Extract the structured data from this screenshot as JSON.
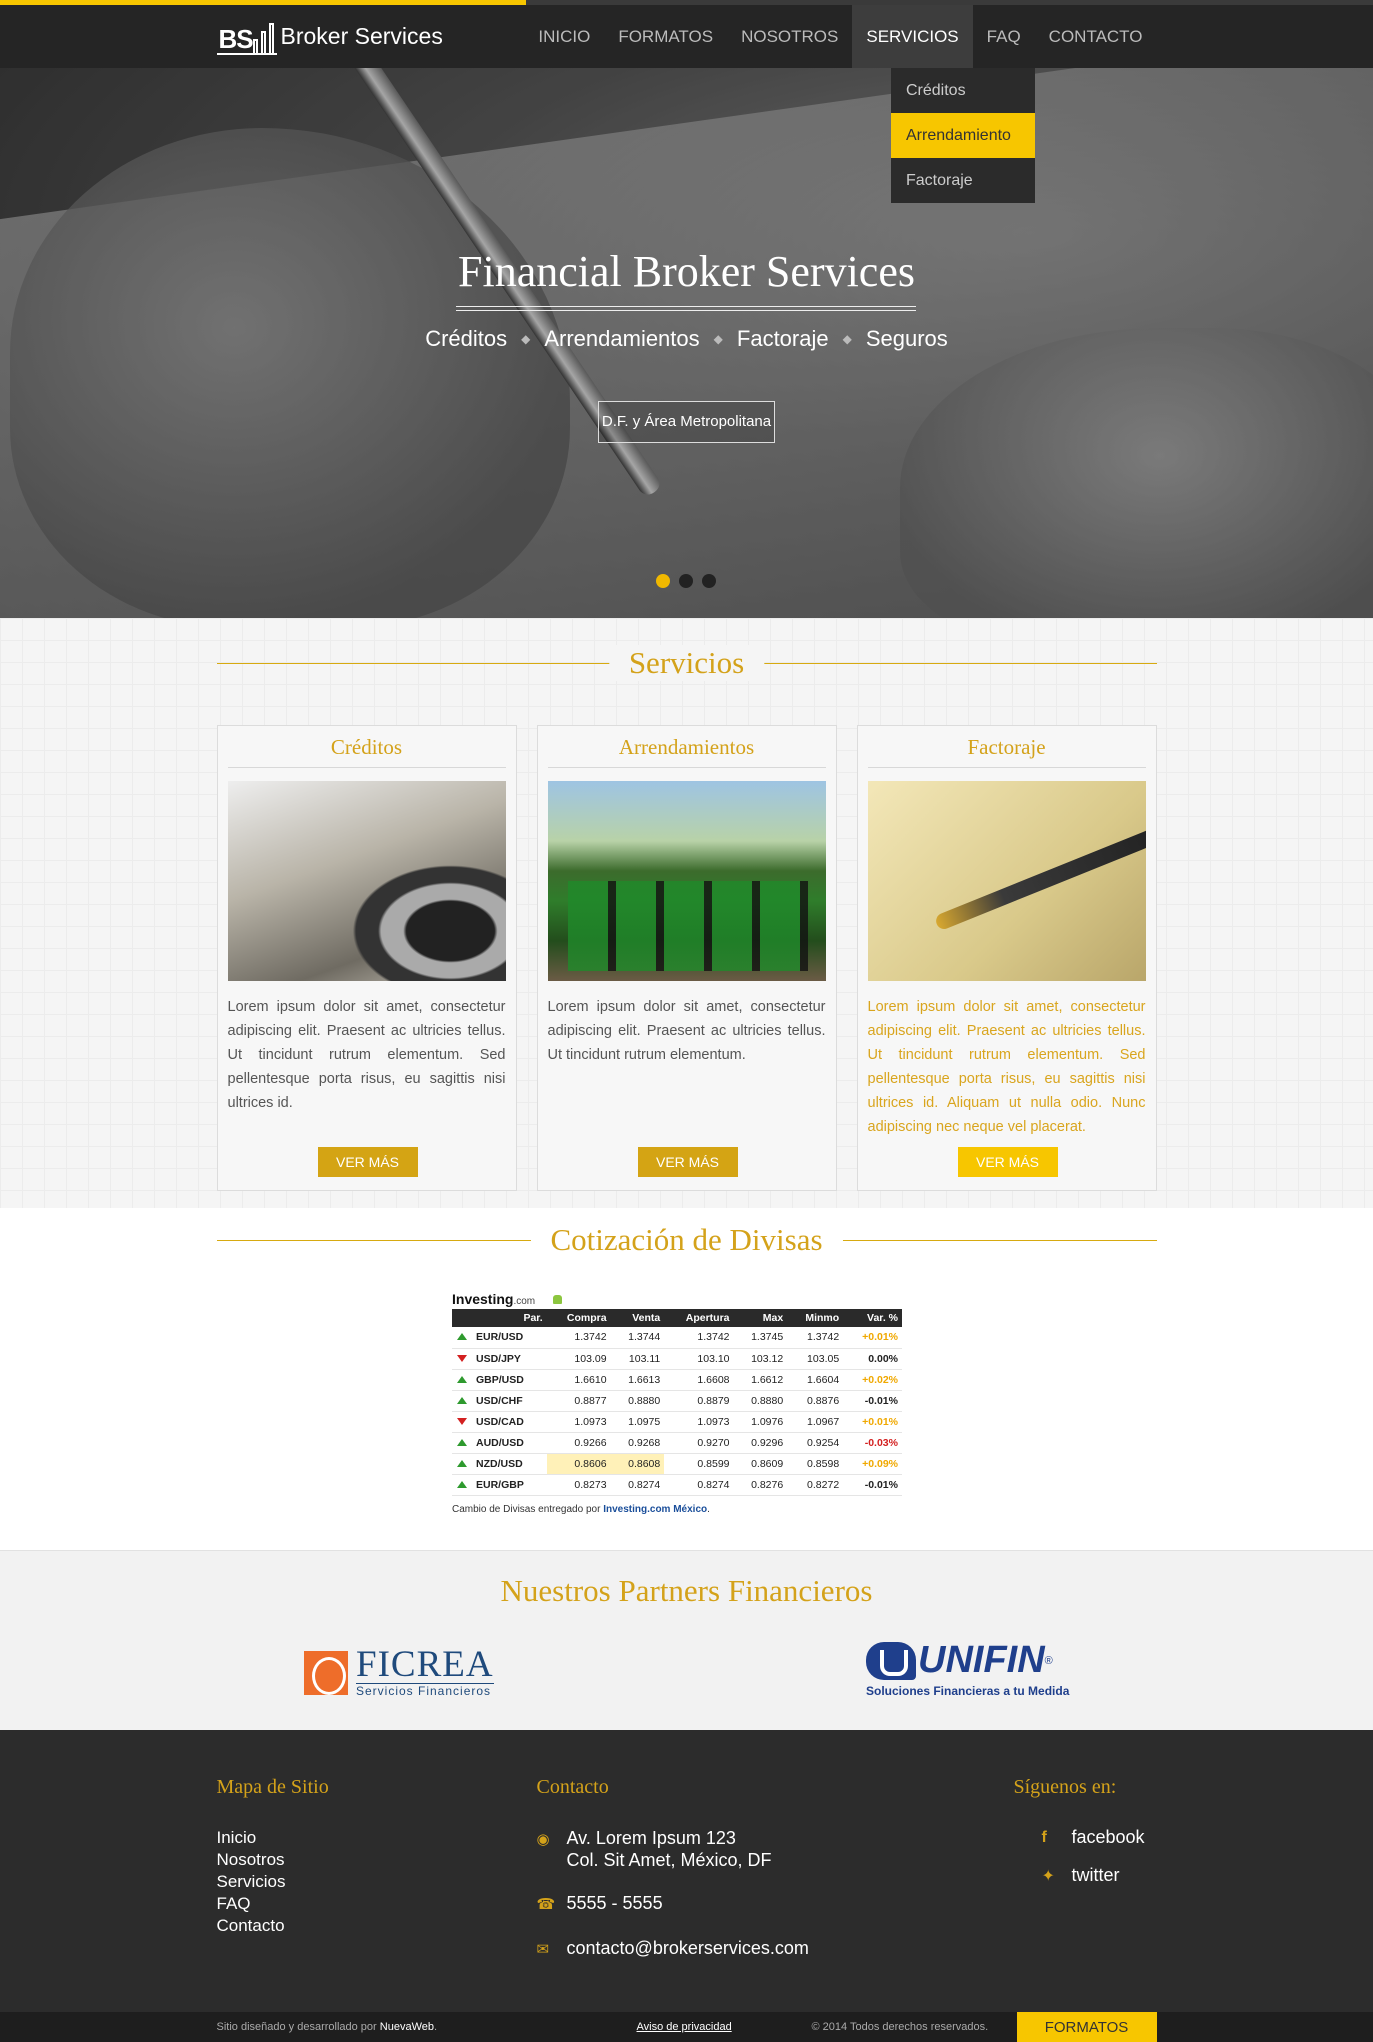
{
  "brand": {
    "logo_text": "BS",
    "name": "Broker Services"
  },
  "nav": {
    "items": [
      "INICIO",
      "FORMATOS",
      "NOSOTROS",
      "SERVICIOS",
      "FAQ",
      "CONTACTO"
    ],
    "active": "SERVICIOS",
    "dropdown": [
      "Créditos",
      "Arrendamiento",
      "Factoraje"
    ],
    "dropdown_highlight": "Arrendamiento"
  },
  "hero": {
    "title": "Financial Broker Services",
    "subtitles": [
      "Créditos",
      "Arrendamientos",
      "Factoraje",
      "Seguros"
    ],
    "separator": "◆",
    "button": "D.F. y Área Metropolitana",
    "slides": 3,
    "active_slide": 1
  },
  "servicios": {
    "title": "Servicios",
    "cards": [
      {
        "title": "Créditos",
        "image": "car-photo",
        "text": "Lorem ipsum dolor sit amet, consectetur adipiscing elit. Praesent ac ultricies tellus. Ut tincidunt rutrum elementum. Sed pellentesque porta risus, eu sagittis nisi ultrices id.",
        "button": "VER MÁS",
        "highlighted": false
      },
      {
        "title": "Arrendamientos",
        "image": "tractor-photo",
        "text": "Lorem ipsum dolor sit amet, consectetur adipiscing elit. Praesent ac ultricies tellus. Ut tincidunt rutrum elementum.",
        "button": "VER MÁS",
        "highlighted": false
      },
      {
        "title": "Factoraje",
        "image": "pen-signature-photo",
        "text": "Lorem ipsum dolor sit amet, consectetur adipiscing elit. Praesent ac ultricies tellus. Ut tincidunt rutrum elementum. Sed pellentesque porta risus, eu sagittis nisi ultrices id. Aliquam ut nulla odio. Nunc adipiscing nec neque vel placerat.",
        "button": "VER MÁS",
        "highlighted": true
      }
    ]
  },
  "divisas": {
    "title": "Cotización de Divisas",
    "widget_brand": "Investing",
    "widget_brand_suffix": ".com",
    "headers": [
      "",
      "Par.",
      "Compra",
      "Venta",
      "Apertura",
      "Max",
      "Minmo",
      "Var. %"
    ],
    "rows": [
      {
        "dir": "up",
        "pair": "EUR/USD",
        "compra": "1.3742",
        "venta": "1.3744",
        "apertura": "1.3742",
        "max": "1.3745",
        "min": "1.3742",
        "var": "+0.01%",
        "var_color": "#f0a800"
      },
      {
        "dir": "down",
        "pair": "USD/JPY",
        "compra": "103.09",
        "venta": "103.11",
        "apertura": "103.10",
        "max": "103.12",
        "min": "103.05",
        "var": "0.00%",
        "var_color": "#222222"
      },
      {
        "dir": "up",
        "pair": "GBP/USD",
        "compra": "1.6610",
        "venta": "1.6613",
        "apertura": "1.6608",
        "max": "1.6612",
        "min": "1.6604",
        "var": "+0.02%",
        "var_color": "#f0a800"
      },
      {
        "dir": "up",
        "pair": "USD/CHF",
        "compra": "0.8877",
        "venta": "0.8880",
        "apertura": "0.8879",
        "max": "0.8880",
        "min": "0.8876",
        "var": "-0.01%",
        "var_color": "#222222"
      },
      {
        "dir": "down",
        "pair": "USD/CAD",
        "compra": "1.0973",
        "venta": "1.0975",
        "apertura": "1.0973",
        "max": "1.0976",
        "min": "1.0967",
        "var": "+0.01%",
        "var_color": "#f0a800"
      },
      {
        "dir": "up",
        "pair": "AUD/USD",
        "compra": "0.9266",
        "venta": "0.9268",
        "apertura": "0.9270",
        "max": "0.9296",
        "min": "0.9254",
        "var": "-0.03%",
        "var_color": "#d32020"
      },
      {
        "dir": "up",
        "pair": "NZD/USD",
        "compra": "0.8606",
        "venta": "0.8608",
        "apertura": "0.8599",
        "max": "0.8609",
        "min": "0.8598",
        "var": "+0.09%",
        "var_color": "#f0a800",
        "highlight": true
      },
      {
        "dir": "up",
        "pair": "EUR/GBP",
        "compra": "0.8273",
        "venta": "0.8274",
        "apertura": "0.8274",
        "max": "0.8276",
        "min": "0.8272",
        "var": "-0.01%",
        "var_color": "#222222"
      }
    ],
    "credit_prefix": "Cambio de Divisas entregado por ",
    "credit_link": "Investing.com México",
    "credit_suffix": "."
  },
  "partners": {
    "title": "Nuestros Partners Financieros",
    "ficrea": {
      "name": "FICREA",
      "tagline": "Servicios Financieros"
    },
    "unifin": {
      "name": "UNIFIN",
      "tagline": "Soluciones Financieras a tu Medida",
      "mark": "®"
    }
  },
  "footer": {
    "sitemap_title": "Mapa de Sitio",
    "sitemap": [
      "Inicio",
      "Nosotros",
      "Servicios",
      "FAQ",
      "Contacto"
    ],
    "contact_title": "Contacto",
    "address_line1": "Av. Lorem Ipsum 123",
    "address_line2": "Col. Sit Amet, México, DF",
    "phone": "5555 - 5555",
    "email": "contacto@brokerservices.com",
    "social_title": "Síguenos en:",
    "facebook": "facebook",
    "twitter": "twitter"
  },
  "bottom_bar": {
    "credit_prefix": "Sitio diseñado y desarrollado por ",
    "credit_link": "NuevaWeb",
    "credit_suffix": ".",
    "privacy": "Aviso de privacidad",
    "copyright": "© 2014 Todos derechos reservados.",
    "formatos": "FORMATOS"
  },
  "colors": {
    "accent": "#d4a21a",
    "highlight": "#f7c600",
    "header_bg": "#252525",
    "footer_bg": "#2c2c2c"
  },
  "icons": {
    "address": "map-marker-icon",
    "phone": "phone-icon",
    "email": "envelope-icon",
    "facebook": "facebook-icon",
    "twitter": "twitter-icon"
  }
}
